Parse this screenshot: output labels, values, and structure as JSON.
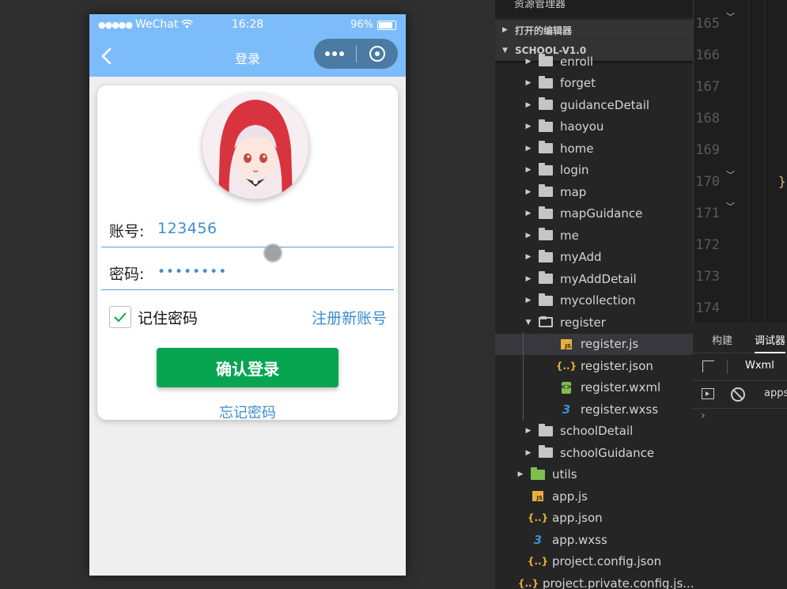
{
  "status_bar": {
    "signal": "●●●●●",
    "carrier": "WeChat",
    "time": "16:28",
    "battery": "96%",
    "battery_level": 0.96
  },
  "nav_bar": {
    "title": "登录"
  },
  "login_form": {
    "account_label": "账号:",
    "account_value": "123456",
    "password_label": "密码:",
    "password_value": "••••••••",
    "remember_label": "记住密码",
    "remember_checked": true,
    "register_link": "注册新账号",
    "login_button": "确认登录",
    "forgot_link": "忘记密码"
  },
  "colors": {
    "nav_blue": "#7dbcfa",
    "link_blue": "#3e8ecf",
    "button_green": "#07a551"
  },
  "explorer": {
    "header": "资源管理器",
    "section_open_editors": "打开的编辑器",
    "section_project": "SCHOOL-V1.0",
    "items": [
      {
        "label": "enroll",
        "type": "folder"
      },
      {
        "label": "forget",
        "type": "folder"
      },
      {
        "label": "guidanceDetail",
        "type": "folder"
      },
      {
        "label": "haoyou",
        "type": "folder"
      },
      {
        "label": "home",
        "type": "folder"
      },
      {
        "label": "login",
        "type": "folder"
      },
      {
        "label": "map",
        "type": "folder"
      },
      {
        "label": "mapGuidance",
        "type": "folder"
      },
      {
        "label": "me",
        "type": "folder"
      },
      {
        "label": "myAdd",
        "type": "folder"
      },
      {
        "label": "myAddDetail",
        "type": "folder"
      },
      {
        "label": "mycollection",
        "type": "folder"
      },
      {
        "label": "register",
        "type": "folder-open"
      },
      {
        "label": "register.js",
        "type": "js"
      },
      {
        "label": "register.json",
        "type": "json"
      },
      {
        "label": "register.wxml",
        "type": "wxml"
      },
      {
        "label": "register.wxss",
        "type": "wxss"
      },
      {
        "label": "schoolDetail",
        "type": "folder"
      },
      {
        "label": "schoolGuidance",
        "type": "folder"
      },
      {
        "label": "utils",
        "type": "folder"
      },
      {
        "label": "app.js",
        "type": "js"
      },
      {
        "label": "app.json",
        "type": "json"
      },
      {
        "label": "app.wxss",
        "type": "wxss"
      },
      {
        "label": "project.config.json",
        "type": "json"
      },
      {
        "label": "project.private.config.js...",
        "type": "json"
      }
    ]
  },
  "editor": {
    "line_numbers": [
      "165",
      "166",
      "167",
      "168",
      "169",
      "170",
      "171",
      "172",
      "173",
      "174"
    ],
    "brace": "}"
  },
  "debug_panel": {
    "tab_build": "构建",
    "tab_debugger": "调试器",
    "wxml_tab": "Wxml",
    "apps_text": "apps",
    "prompt": "›"
  }
}
